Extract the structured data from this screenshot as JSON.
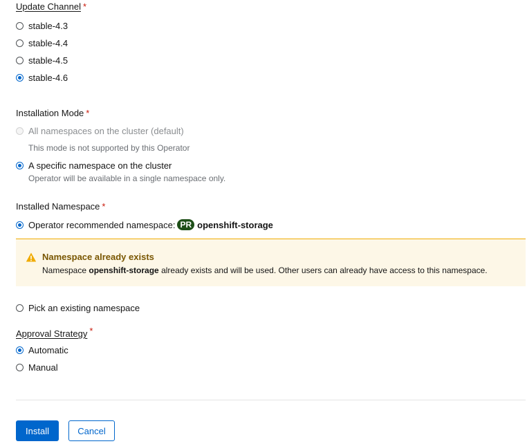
{
  "update_channel": {
    "label": "Update Channel",
    "required_mark": "*",
    "options": [
      {
        "label": "stable-4.3",
        "checked": false
      },
      {
        "label": "stable-4.4",
        "checked": false
      },
      {
        "label": "stable-4.5",
        "checked": false
      },
      {
        "label": "stable-4.6",
        "checked": true
      }
    ]
  },
  "installation_mode": {
    "label": "Installation Mode",
    "required_mark": "*",
    "options": [
      {
        "label": "All namespaces on the cluster (default)",
        "help": "This mode is not supported by this Operator",
        "checked": false,
        "disabled": true
      },
      {
        "label": "A specific namespace on the cluster",
        "help": "Operator will be available in a single namespace only.",
        "checked": true,
        "disabled": false
      }
    ]
  },
  "installed_namespace": {
    "label": "Installed Namespace",
    "required_mark": "*",
    "recommended_label": "Operator recommended namespace:",
    "badge": "PR",
    "namespace": "openshift-storage",
    "pick_existing_label": "Pick an existing namespace",
    "alert": {
      "title": "Namespace already exists",
      "body_prefix": "Namespace",
      "body_namespace": "openshift-storage",
      "body_suffix": "already exists and will be used. Other users can already have access to this namespace."
    }
  },
  "approval_strategy": {
    "label": "Approval Strategy",
    "required_mark": "*",
    "options": [
      {
        "label": "Automatic",
        "checked": true
      },
      {
        "label": "Manual",
        "checked": false
      }
    ]
  },
  "actions": {
    "install_label": "Install",
    "cancel_label": "Cancel"
  },
  "colors": {
    "primary": "#0066cc",
    "required": "#c9190b",
    "warning_title": "#795600",
    "warning_bg": "#fdf7e7",
    "warning_border": "#f0ab00",
    "badge_bg": "#1e4f18"
  }
}
